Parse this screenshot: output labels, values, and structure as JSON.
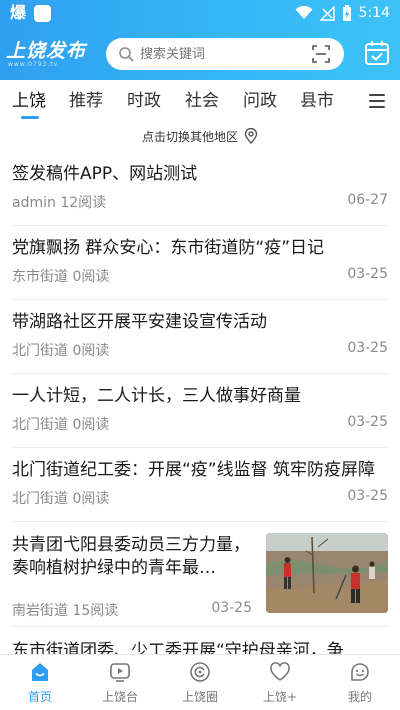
{
  "status_bar": {
    "app_glyph": "爆",
    "time": "5:14"
  },
  "header": {
    "logo": "上饶发布",
    "logo_sub": "www.0793.tv",
    "search_placeholder": "搜索关键词",
    "search_icon": "search-icon",
    "scan_icon": "scan-icon",
    "calendar_icon": "calendar-check-icon"
  },
  "tabs": [
    "上饶",
    "推荐",
    "时政",
    "社会",
    "问政",
    "县市"
  ],
  "active_tab": "上饶",
  "region_switch": {
    "label": "点击切换其他地区",
    "icon": "location-pin-icon"
  },
  "news": [
    {
      "title": "签发稿件APP、网站测试",
      "source": "admin",
      "reads": "12阅读",
      "date": "06-27"
    },
    {
      "title": "党旗飘扬 群众安心：东市街道防“疫”日记",
      "source": "东市街道",
      "reads": "0阅读",
      "date": "03-25"
    },
    {
      "title": "带湖路社区开展平安建设宣传活动",
      "source": "北门街道",
      "reads": "0阅读",
      "date": "03-25"
    },
    {
      "title": "一人计短，二人计长，三人做事好商量",
      "source": "北门街道",
      "reads": "0阅读",
      "date": "03-25"
    },
    {
      "title": "北门街道纪工委：开展“疫”线监督 筑牢防疫屏障",
      "source": "北门街道",
      "reads": "0阅读",
      "date": "03-25"
    },
    {
      "title": "共青团弋阳县委动员三方力量，奏响植树护绿中的青年最…",
      "source": "南岩街道",
      "reads": "15阅读",
      "date": "03-25",
      "has_image": true
    },
    {
      "title": "东市街道团委、少工委开展“守护母亲河，争",
      "partial": true
    }
  ],
  "bottom_nav": [
    {
      "label": "首页",
      "icon": "home-icon",
      "active": true
    },
    {
      "label": "上饶台",
      "icon": "tv-play-icon",
      "active": false
    },
    {
      "label": "上饶圈",
      "icon": "circle-swirl-icon",
      "active": false
    },
    {
      "label": "上饶+",
      "icon": "heart-icon",
      "active": false
    },
    {
      "label": "我的",
      "icon": "smile-face-icon",
      "active": false
    }
  ],
  "colors": {
    "brand_blue": "#2e9cf0",
    "text_primary": "#1a1a1a",
    "text_meta": "#8a8a8a"
  }
}
